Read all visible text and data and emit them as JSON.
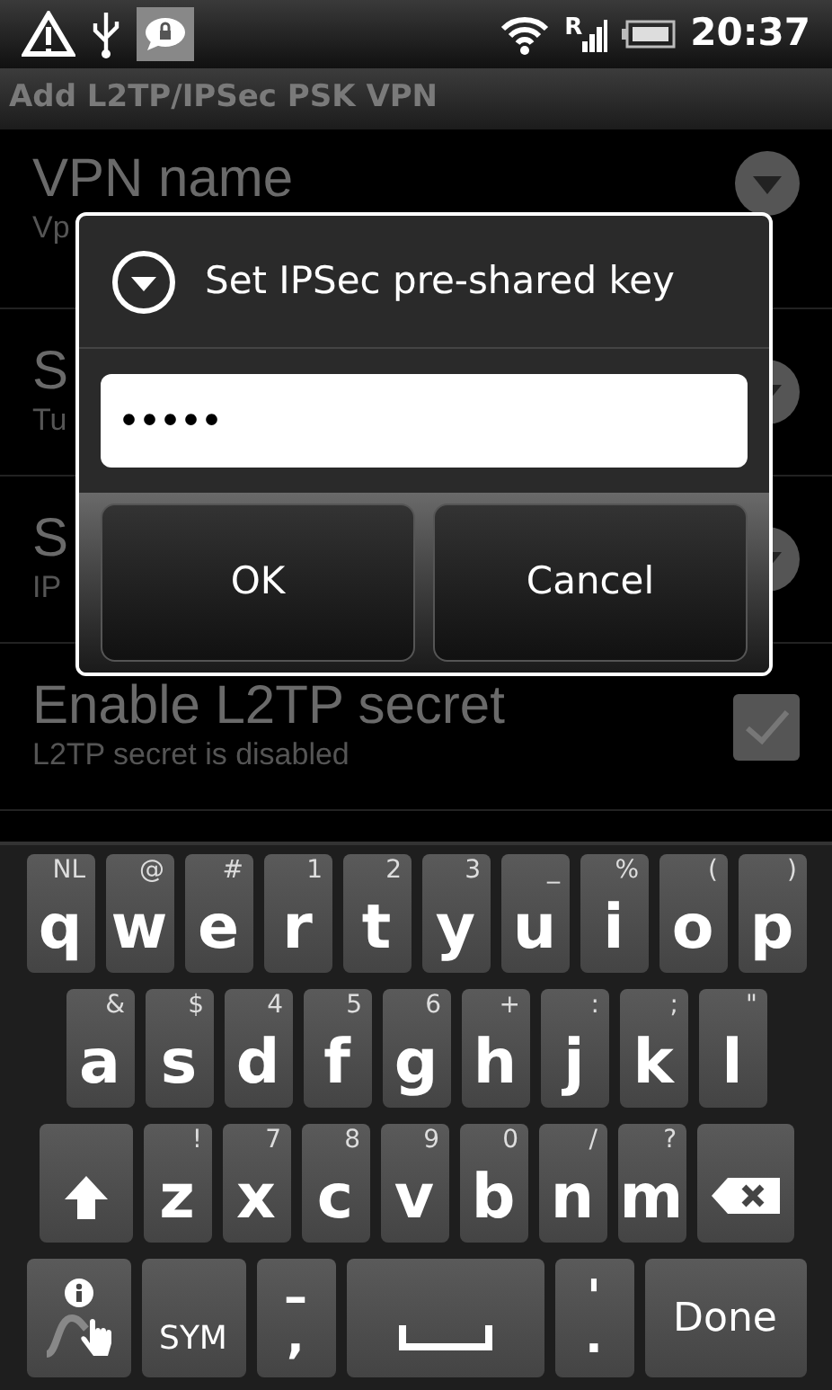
{
  "status_bar": {
    "time": "20:37",
    "roaming": "R"
  },
  "title_bar": {
    "title": "Add L2TP/IPSec PSK VPN"
  },
  "settings": [
    {
      "kind": "dropdown",
      "title": "VPN name",
      "summary": "Vp"
    },
    {
      "kind": "dropdown",
      "title": "S",
      "summary": "Tu"
    },
    {
      "kind": "dropdown",
      "title": "S",
      "summary": "IP"
    },
    {
      "kind": "checkbox",
      "title": "Enable L2TP secret",
      "summary": "L2TP secret is disabled",
      "checked": true
    }
  ],
  "dialog": {
    "title": "Set IPSec pre-shared key",
    "value": "•••••",
    "buttons": [
      "OK",
      "Cancel"
    ]
  },
  "keyboard": {
    "rows": [
      {
        "keys": [
          {
            "kind": "letter",
            "label": "q",
            "hint": "NL"
          },
          {
            "kind": "letter",
            "label": "w",
            "hint": "@"
          },
          {
            "kind": "letter",
            "label": "e",
            "hint": "#"
          },
          {
            "kind": "letter",
            "label": "r",
            "hint": "1"
          },
          {
            "kind": "letter",
            "label": "t",
            "hint": "2"
          },
          {
            "kind": "letter",
            "label": "y",
            "hint": "3"
          },
          {
            "kind": "letter",
            "label": "u",
            "hint": "_"
          },
          {
            "kind": "letter",
            "label": "i",
            "hint": "%"
          },
          {
            "kind": "letter",
            "label": "o",
            "hint": "("
          },
          {
            "kind": "letter",
            "label": "p",
            "hint": ")"
          }
        ]
      },
      {
        "keys": [
          {
            "kind": "letter",
            "label": "a",
            "hint": "&"
          },
          {
            "kind": "letter",
            "label": "s",
            "hint": "$"
          },
          {
            "kind": "letter",
            "label": "d",
            "hint": "4"
          },
          {
            "kind": "letter",
            "label": "f",
            "hint": "5"
          },
          {
            "kind": "letter",
            "label": "g",
            "hint": "6"
          },
          {
            "kind": "letter",
            "label": "h",
            "hint": "+"
          },
          {
            "kind": "letter",
            "label": "j",
            "hint": ":"
          },
          {
            "kind": "letter",
            "label": "k",
            "hint": ";"
          },
          {
            "kind": "letter",
            "label": "l",
            "hint": "\""
          }
        ]
      },
      {
        "keys": [
          {
            "kind": "shift"
          },
          {
            "kind": "letter",
            "label": "z",
            "hint": "!"
          },
          {
            "kind": "letter",
            "label": "x",
            "hint": "7"
          },
          {
            "kind": "letter",
            "label": "c",
            "hint": "8"
          },
          {
            "kind": "letter",
            "label": "v",
            "hint": "9"
          },
          {
            "kind": "letter",
            "label": "b",
            "hint": "0"
          },
          {
            "kind": "letter",
            "label": "n",
            "hint": "/"
          },
          {
            "kind": "letter",
            "label": "m",
            "hint": "?"
          },
          {
            "kind": "backspace"
          }
        ]
      },
      {
        "keys": [
          {
            "kind": "input_method"
          },
          {
            "kind": "text",
            "label": "SYM"
          },
          {
            "kind": "pair",
            "hint": "–",
            "label": ","
          },
          {
            "kind": "space"
          },
          {
            "kind": "pair",
            "hint": "'",
            "label": "."
          },
          {
            "kind": "text",
            "label": "Done"
          }
        ]
      }
    ]
  }
}
